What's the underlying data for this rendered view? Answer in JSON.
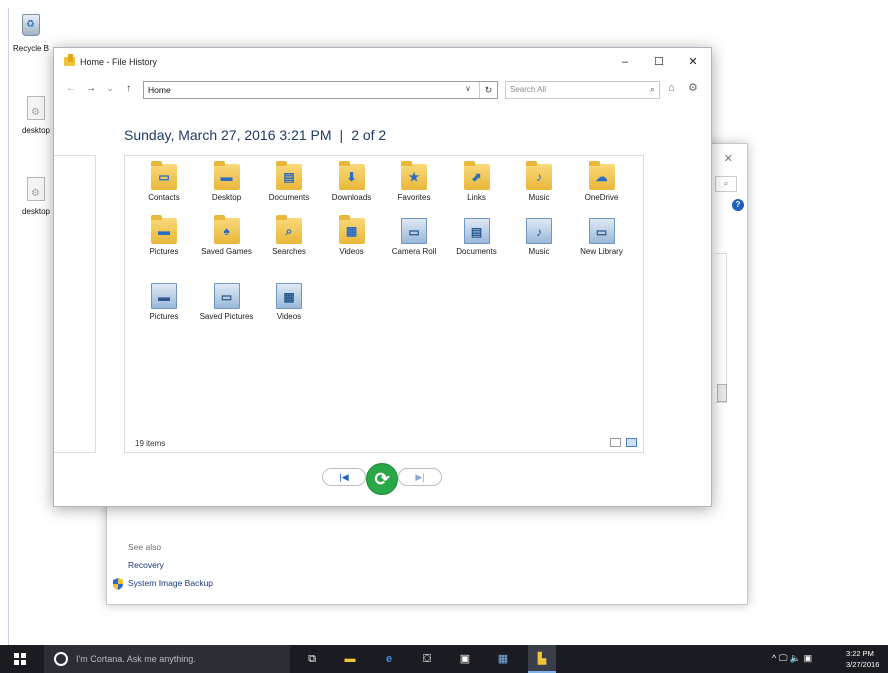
{
  "desktop": {
    "icons": [
      {
        "label": "Recycle B"
      },
      {
        "label": "desktop"
      },
      {
        "label": "desktop"
      }
    ]
  },
  "file_history": {
    "title": "Home - File History",
    "window_controls": {
      "minimize": "–",
      "maximize": "☐",
      "close": "✕"
    },
    "nav": {
      "back": "←",
      "forward": "→",
      "recent": "⌄",
      "up": "↑"
    },
    "address": {
      "value": "Home",
      "dropdown": "∨",
      "refresh": "↻"
    },
    "search": {
      "placeholder": "Search All",
      "icon": "⌕"
    },
    "home_icon": "⌂",
    "settings_icon": "⚙",
    "date": "Sunday, March 27, 2016 3:21 PM",
    "separator": "|",
    "page": "2 of 2",
    "items": [
      {
        "label": "Contacts",
        "type": "folder",
        "icon": "contacts-icon",
        "glyph": "▭"
      },
      {
        "label": "Desktop",
        "type": "folder",
        "icon": "desktop-folder-icon",
        "glyph": "▬"
      },
      {
        "label": "Documents",
        "type": "folder",
        "icon": "documents-icon",
        "glyph": "▤"
      },
      {
        "label": "Downloads",
        "type": "folder",
        "icon": "downloads-icon",
        "glyph": "⬇"
      },
      {
        "label": "Favorites",
        "type": "folder",
        "icon": "favorites-icon",
        "glyph": "★"
      },
      {
        "label": "Links",
        "type": "folder",
        "icon": "links-icon",
        "glyph": "⬈"
      },
      {
        "label": "Music",
        "type": "folder",
        "icon": "music-icon",
        "glyph": "♪"
      },
      {
        "label": "OneDrive",
        "type": "folder",
        "icon": "onedrive-icon",
        "glyph": "☁"
      },
      {
        "label": "Pictures",
        "type": "folder",
        "icon": "pictures-icon",
        "glyph": "▬"
      },
      {
        "label": "Saved Games",
        "type": "folder",
        "icon": "saved-games-icon",
        "glyph": "♠"
      },
      {
        "label": "Searches",
        "type": "folder",
        "icon": "searches-icon",
        "glyph": "⌕"
      },
      {
        "label": "Videos",
        "type": "folder",
        "icon": "videos-icon",
        "glyph": "▦"
      },
      {
        "label": "Camera Roll",
        "type": "library",
        "icon": "camera-roll-icon",
        "glyph": "▭"
      },
      {
        "label": "Documents",
        "type": "library",
        "icon": "documents-library-icon",
        "glyph": "▤"
      },
      {
        "label": "Music",
        "type": "library",
        "icon": "music-library-icon",
        "glyph": "♪"
      },
      {
        "label": "New Library",
        "type": "library",
        "icon": "new-library-icon",
        "glyph": "▭"
      },
      {
        "label": "Pictures",
        "type": "library",
        "icon": "pictures-library-icon",
        "glyph": "▬"
      },
      {
        "label": "Saved Pictures",
        "type": "library",
        "icon": "saved-pictures-icon",
        "glyph": "▭"
      },
      {
        "label": "Videos",
        "type": "library",
        "icon": "videos-library-icon",
        "glyph": "▦"
      }
    ],
    "status": "19 items",
    "playback": {
      "previous": "|◀",
      "restore": "⟳",
      "next": "▶|"
    }
  },
  "back_window": {
    "close": "✕",
    "search_icon": "⌕",
    "help": "?",
    "see_also": "See also",
    "links": [
      "Recovery",
      "System Image Backup"
    ]
  },
  "taskbar": {
    "cortana_placeholder": "I'm Cortana. Ask me anything.",
    "tray": "^ 🖵 🔈 ▣",
    "time": "3:22 PM",
    "date": "3/27/2016"
  },
  "colors": {
    "accent_blue": "#1e3b66",
    "restore_green": "#2aa847",
    "folder_yellow": "#f0c33c",
    "taskbar": "#1a1c22"
  }
}
